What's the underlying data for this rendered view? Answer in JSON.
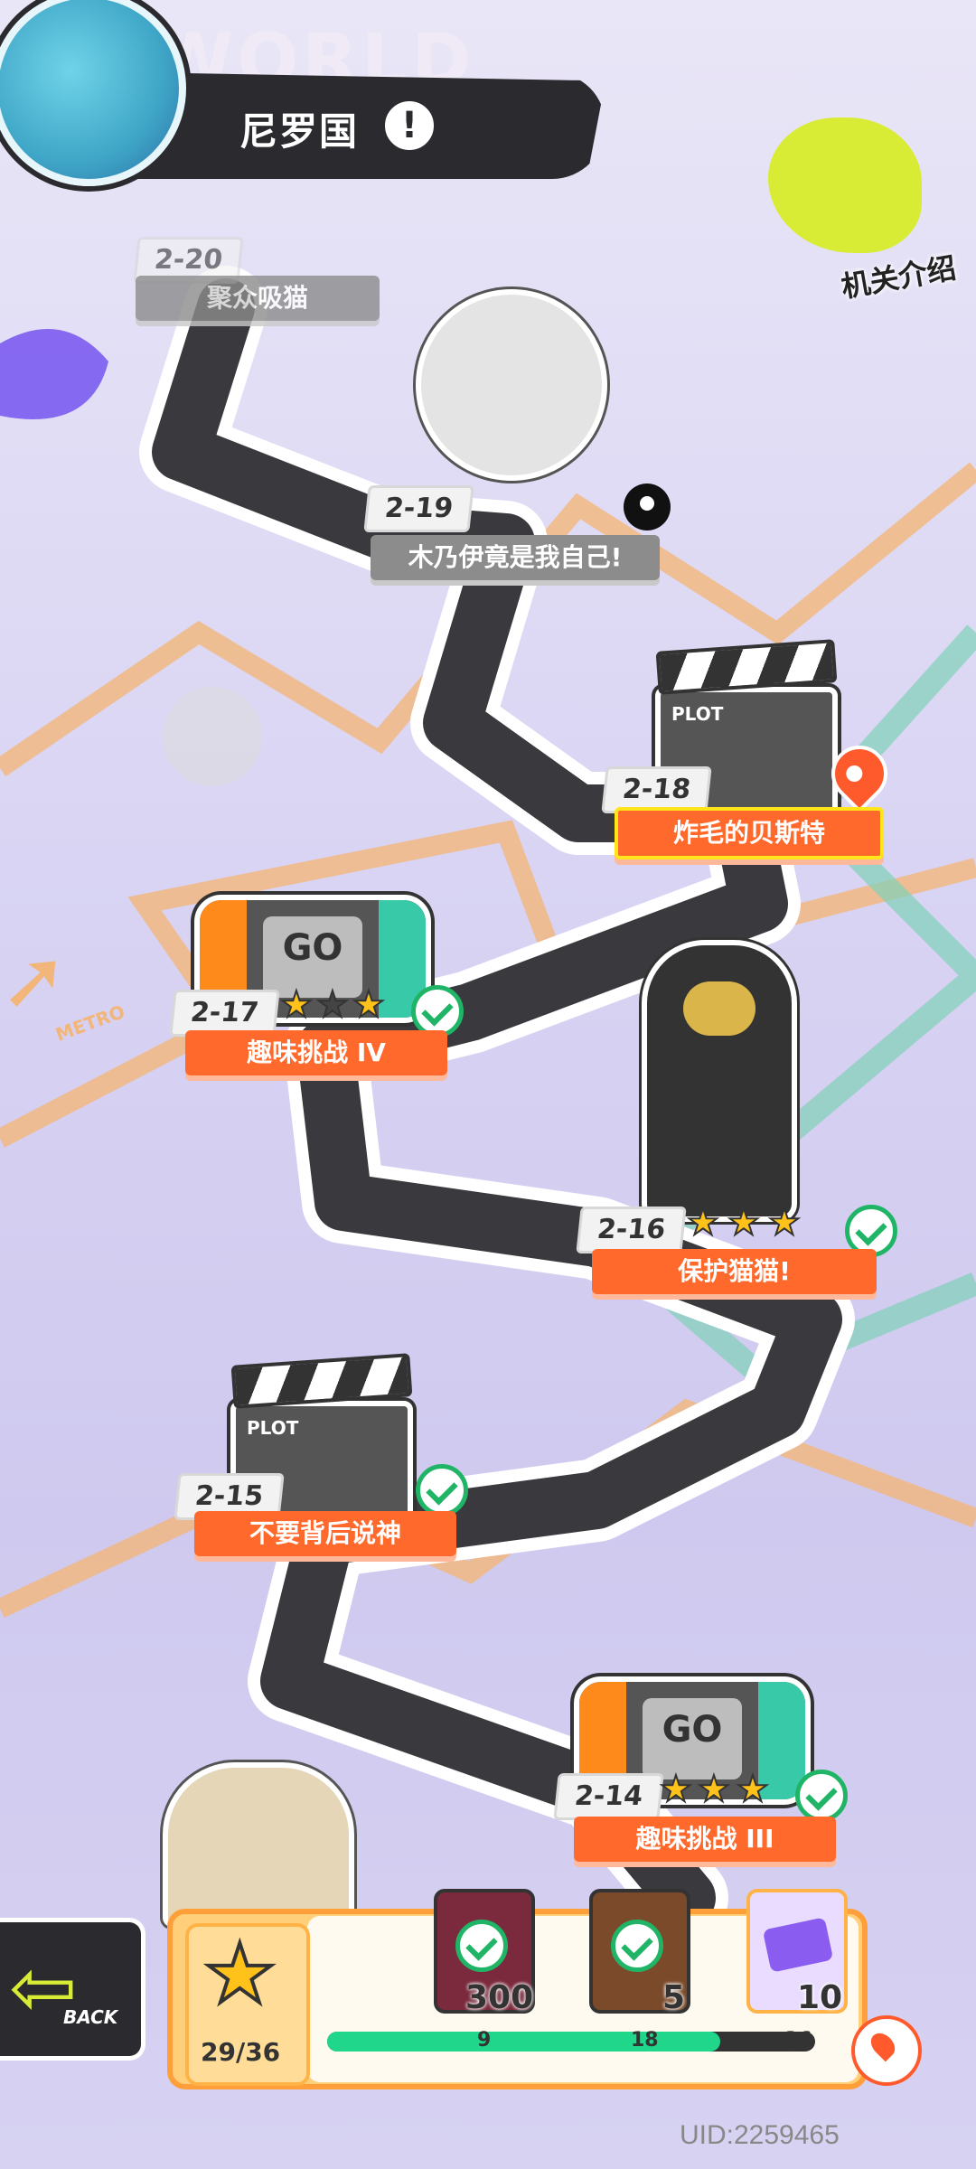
{
  "header": {
    "world_label": "WORLD",
    "region_title": "尼罗国",
    "alert_symbol": "!"
  },
  "mechanism_intro": {
    "label": "机关介绍"
  },
  "levels": [
    {
      "num": "2-20",
      "name": "聚众吸猫",
      "state": "locked"
    },
    {
      "num": "2-19",
      "name": "木乃伊竟是我自己!",
      "state": "locked"
    },
    {
      "num": "2-18",
      "name": "炸毛的贝斯特",
      "state": "current"
    },
    {
      "num": "2-17",
      "name": "趣味挑战 IV",
      "state": "cleared",
      "stars": 2
    },
    {
      "num": "2-16",
      "name": "保护猫猫!",
      "state": "cleared",
      "stars": 3
    },
    {
      "num": "2-15",
      "name": "不要背后说神",
      "state": "cleared"
    },
    {
      "num": "2-14",
      "name": "趣味挑战 III",
      "state": "cleared",
      "stars": 3
    }
  ],
  "illustrations": {
    "plot_label": "PLOT",
    "go_label": "GO",
    "metro_label": "METRO",
    "mystery_mark": "?"
  },
  "back_button": {
    "label": "BACK"
  },
  "rewards": {
    "stars_collected": "29/36",
    "progress": {
      "current": 29,
      "max": 36
    },
    "milestones": [
      {
        "at": "9",
        "qty": "300",
        "claimed": true
      },
      {
        "at": "18",
        "qty": "5",
        "claimed": true
      },
      {
        "at": "36",
        "qty": "10",
        "claimed": false
      }
    ]
  },
  "footer": {
    "uid": "UID:2259465"
  },
  "colors": {
    "accent_orange": "#ff6a2c",
    "path": "#333333",
    "cleared_green": "#20b566",
    "star_yellow": "#ffc21a"
  }
}
